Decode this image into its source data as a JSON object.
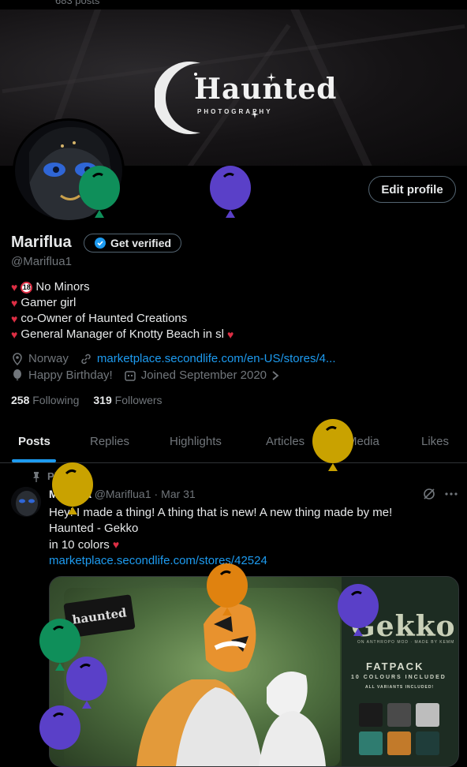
{
  "top": {
    "post_count": "683 posts"
  },
  "banner": {
    "logo_title": "Haunted",
    "logo_subtitle": "PHOTOGRAPHY"
  },
  "actions": {
    "edit_profile": "Edit profile",
    "get_verified": "Get verified"
  },
  "profile": {
    "name": "Mariflua",
    "handle": "@Mariflua1",
    "bio": [
      "No Minors",
      "Gamer girl",
      "co-Owner of Haunted Creations",
      "General Manager of Knotty Beach in sl"
    ],
    "badge_18": "18",
    "location": "Norway",
    "website": "marketplace.secondlife.com/en-US/stores/4...",
    "birthday": "Happy Birthday!",
    "joined": "Joined September 2020",
    "following_count": "258",
    "following_label": "Following",
    "followers_count": "319",
    "followers_label": "Followers"
  },
  "tabs": [
    "Posts",
    "Replies",
    "Highlights",
    "Articles",
    "Media",
    "Likes"
  ],
  "tweet": {
    "pinned_label": "Pinned",
    "author": "Mariflua",
    "handle": "@Mariflua1",
    "dot": "·",
    "date": "Mar 31",
    "line1": "Hey! I made a thing! A thing that is new! A new thing made by me!",
    "line2": "Haunted - Gekko",
    "line3": "in 10 colors",
    "link": "marketplace.secondlife.com/stores/42524"
  },
  "media": {
    "sign_text": "haunted",
    "title": "Gekko",
    "sub": "ON ANTHROPO MOD · MADE BY KEMM",
    "fatpack": "FATPACK",
    "colours": "10 COLOURS INCLUDED",
    "variants": "ALL VARIANTS INCLUDED!"
  },
  "colors": {
    "accent": "#1d9bf0",
    "heart": "#dd2e44",
    "muted": "#71767b",
    "balloon_green": "#0f8f5a",
    "balloon_purple": "#5a40c8",
    "balloon_yellow": "#c9a200",
    "balloon_orange": "#e0820f"
  },
  "icons": [
    "location-icon",
    "link-icon",
    "balloon-icon",
    "calendar-icon",
    "chevron-right-icon",
    "verified-icon",
    "pin-icon",
    "grok-icon",
    "more-icon"
  ]
}
